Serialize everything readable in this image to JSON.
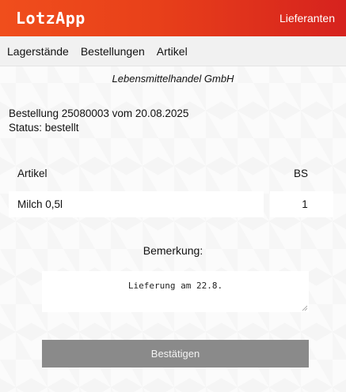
{
  "header": {
    "logo": "LotzApp",
    "right_link": "Lieferanten",
    "gradient_start": "#f04e1c",
    "gradient_end": "#d6221e"
  },
  "nav": {
    "items": [
      "Lagerstände",
      "Bestellungen",
      "Artikel"
    ]
  },
  "company": "Lebensmittelhandel GmbH",
  "order": {
    "line": "Bestellung 25080003 vom 20.08.2025",
    "status": "Status: bestellt"
  },
  "table": {
    "headers": [
      "Artikel",
      "BS"
    ],
    "rows": [
      {
        "artikel": "Milch 0,5l",
        "bs": "1"
      }
    ]
  },
  "remark": {
    "label": "Bemerkung:",
    "value": "Lieferung am 22.8."
  },
  "confirm_button": {
    "label": "Bestätigen",
    "color": "#8a8a8a"
  }
}
